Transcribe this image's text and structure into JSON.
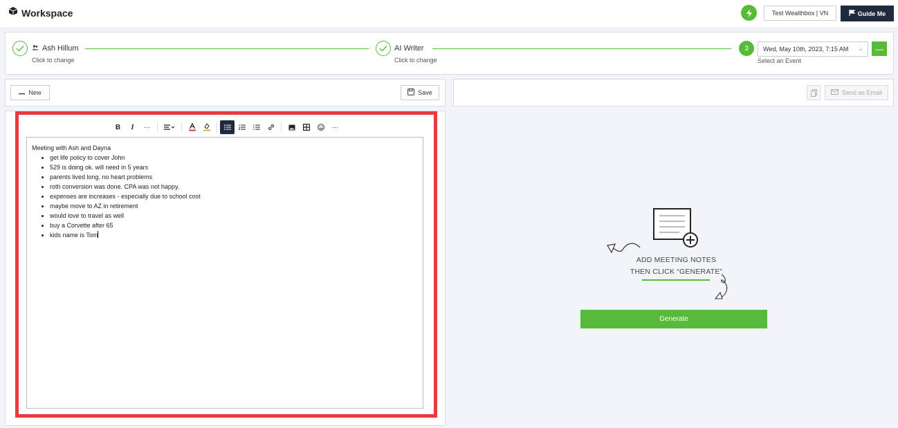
{
  "app": {
    "title": "Workspace"
  },
  "header": {
    "account_label": "Test Wealthbox | VN",
    "guide_label": "Guide Me"
  },
  "stepper": {
    "steps": [
      {
        "title": "Ash Hillum",
        "subtitle": "Click to change",
        "status": "complete"
      },
      {
        "title": "AI Writer",
        "subtitle": "Click to change",
        "status": "complete"
      },
      {
        "number": "3",
        "subtitle": "Select an Event",
        "status": "active"
      }
    ],
    "event_value": "Wed, May 10th, 2023, 7:15 AM",
    "minus_label": "—"
  },
  "left_toolbar": {
    "new_label": "New",
    "save_label": "Save"
  },
  "right_toolbar": {
    "send_label": "Send as Email"
  },
  "editor": {
    "heading": "Meeting with Ash and Dayna",
    "items": [
      "get life policy to cover John",
      "529 is doing ok. will need in 5 years",
      "parents lived long. no heart problems",
      "roth conversion was done. CPA was not happy.",
      "expenses are increases - especially due to school cost",
      "maybe move to AZ in retirement",
      "would love to travel as well",
      "buy a Corvette after 65",
      "kids name is Tom"
    ],
    "toolbar": [
      "bold-icon",
      "italic-icon",
      "more-icon",
      "align-icon",
      "font-color-icon",
      "highlight-icon",
      "bullet-list-icon",
      "numbered-list-icon",
      "checklist-icon",
      "link-icon",
      "image-icon",
      "table-icon",
      "emoji-icon",
      "more-icon"
    ]
  },
  "illustration": {
    "line1": "ADD MEETING NOTES",
    "line2": "THEN CLICK “GENERATE”"
  },
  "generate_label": "Generate",
  "colors": {
    "accent": "#57ba38",
    "dark": "#1f2a3c",
    "highlight_border": "#e83a3f"
  }
}
